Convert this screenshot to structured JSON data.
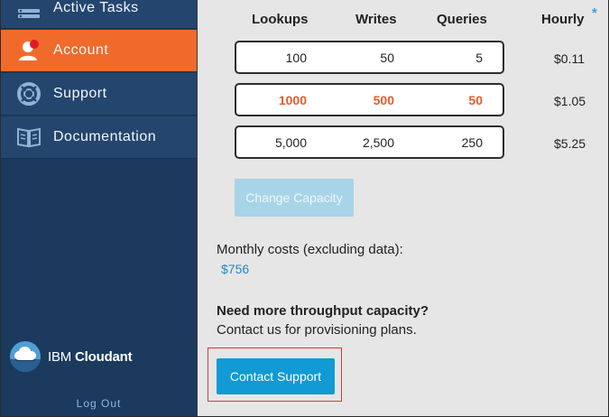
{
  "sidebar": {
    "items": [
      {
        "label": "Active Tasks",
        "icon": "tasks-list-icon",
        "active": false
      },
      {
        "label": "Account",
        "icon": "user-account-icon",
        "active": true
      },
      {
        "label": "Support",
        "icon": "lifebuoy-icon",
        "active": false
      },
      {
        "label": "Documentation",
        "icon": "book-icon",
        "active": false
      }
    ],
    "brand": {
      "ibm": "IBM",
      "cloudant": "Cloudant"
    },
    "logout_label": "Log Out"
  },
  "table": {
    "headers": {
      "lookups": "Lookups",
      "writes": "Writes",
      "queries": "Queries",
      "hourly": "Hourly"
    },
    "asterisk": "*",
    "rows": [
      {
        "lookups": "100",
        "writes": "50",
        "queries": "5",
        "hourly": "$0.11",
        "selected": false
      },
      {
        "lookups": "1000",
        "writes": "500",
        "queries": "50",
        "hourly": "$1.05",
        "selected": true
      },
      {
        "lookups": "5,000",
        "writes": "2,500",
        "queries": "250",
        "hourly": "$5.25",
        "selected": false
      }
    ]
  },
  "change_capacity_label": "Change Capacity",
  "monthly": {
    "label": "Monthly costs (excluding data):",
    "value": "$756"
  },
  "need_more": {
    "title": "Need more throughput capacity?",
    "body": "Contact us for provisioning plans."
  },
  "contact_support_label": "Contact Support",
  "colors": {
    "sidebar_bg": "#1b3a5e",
    "nav_item_bg": "#24466e",
    "active_accent": "#f06b2b",
    "selected_text": "#e8592a",
    "link_blue": "#1e88c8",
    "primary_button": "#119ad3",
    "disabled_button": "#a8d4e8",
    "highlight_border": "#d9363a"
  }
}
